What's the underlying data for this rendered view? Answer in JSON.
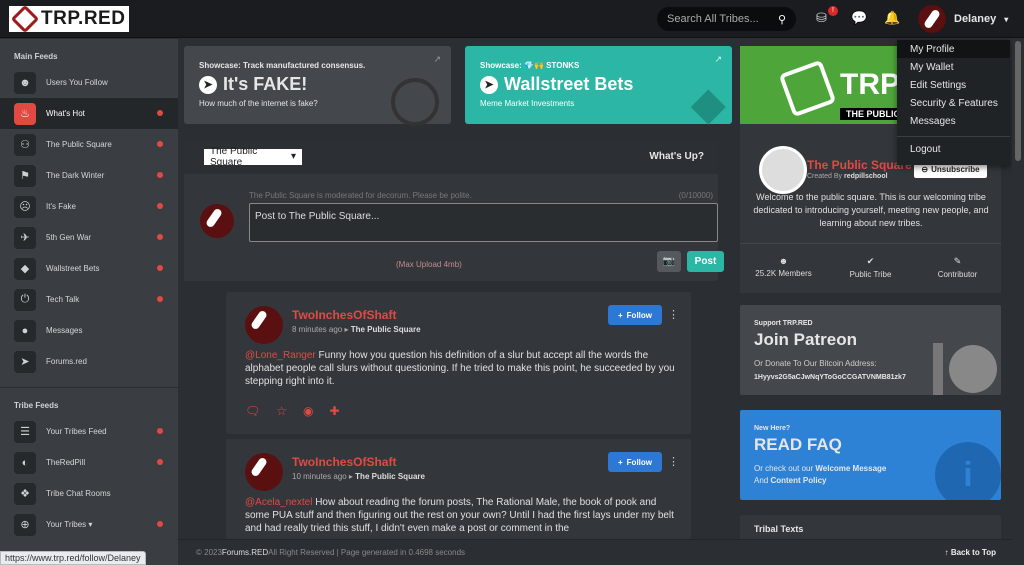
{
  "brand": {
    "logo": "TRP.RED"
  },
  "header": {
    "search_placeholder": "Search All Tribes...",
    "notification_count": "!",
    "username": "Delaney"
  },
  "user_menu": [
    "My Profile",
    "My Wallet",
    "Edit Settings",
    "Security & Features",
    "Messages",
    "Logout"
  ],
  "sidebar": {
    "main_title": "Main Feeds",
    "main": [
      {
        "label": "Users You Follow",
        "icon": "users-icon",
        "dot": false
      },
      {
        "label": "What's Hot",
        "icon": "fire-icon",
        "dot": true,
        "active": true
      },
      {
        "label": "The Public Square",
        "icon": "group-icon",
        "dot": true
      },
      {
        "label": "The Dark Winter",
        "icon": "flag-icon",
        "dot": true
      },
      {
        "label": "It's Fake",
        "icon": "dizzy-face-icon",
        "dot": true
      },
      {
        "label": "5th Gen War",
        "icon": "jet-icon",
        "dot": true
      },
      {
        "label": "Wallstreet Bets",
        "icon": "diamond-icon",
        "dot": true
      },
      {
        "label": "Tech Talk",
        "icon": "power-icon",
        "dot": true
      },
      {
        "label": "Messages",
        "icon": "chat-icon",
        "dot": false
      },
      {
        "label": "Forums.red",
        "icon": "arrow-circle-icon",
        "dot": false
      }
    ],
    "tribe_title": "Tribe Feeds",
    "tribe": [
      {
        "label": "Your Tribes Feed",
        "icon": "list-icon",
        "dot": true
      },
      {
        "label": "TheRedPill",
        "icon": "pills-icon",
        "dot": true
      },
      {
        "label": "Tribe Chat Rooms",
        "icon": "chat-bubbles-icon",
        "dot": false
      },
      {
        "label": "Your Tribes ▾",
        "icon": "globe-icon",
        "dot": true
      }
    ]
  },
  "showcase": [
    {
      "kicker": "Showcase: Track manufactured consensus.",
      "title": "It's FAKE!",
      "sub": "How much of the internet is fake?",
      "color": "#44484c"
    },
    {
      "kicker": "Showcase: 💎🙌 STONKS",
      "title": "Wallstreet Bets",
      "sub": "Meme Market Investments",
      "color": "#2bb6a5"
    }
  ],
  "composer": {
    "tribe_select": "The Public Square",
    "whats_up": "What's Up?",
    "note": "The Public Square is moderated for decorum. Please be polite.",
    "counter": "(0/10000)",
    "placeholder": "Post to The Public Square...",
    "max_upload": "(Max Upload 4mb)",
    "post": "Post"
  },
  "posts": [
    {
      "author": "TwoInchesOfShaft",
      "time": "8 minutes ago",
      "tribe": "The Public Square",
      "mention": "@Lone_Ranger",
      "text": " Funny how you question his definition of a slur but accept all the words the alphabet people call slurs without questioning. If he tried to make this point, he succeeded by you stepping right into it.",
      "follow": "Follow"
    },
    {
      "author": "TwoInchesOfShaft",
      "time": "10 minutes ago",
      "tribe": "The Public Square",
      "mention": "@Acela_nextel",
      "text": " How about reading the forum posts, The Rational Male, the book of pook and some PUA stuff and then figuring out the rest on your own? Until I had the first lays under my belt and had really tried this stuff, I didn't even make a post or comment in the",
      "follow": "Follow"
    }
  ],
  "tribe_card": {
    "banner": "TRP.RED",
    "banner_sub": "THE PUBLIC SQUARE",
    "name": "The Public Square",
    "created_by_label": "Created By",
    "created_by": "redpillschool",
    "unsubscribe": "Unsubscribe",
    "description": "Welcome to the public square. This is our welcoming tribe dedicated to introducing yourself, meeting new people, and learning about new tribes.",
    "stats": [
      {
        "label": "25.2K Members",
        "icon": "users-icon"
      },
      {
        "label": "Public Tribe",
        "icon": "check-icon"
      },
      {
        "label": "Contributor",
        "icon": "pen-icon"
      }
    ]
  },
  "support": {
    "kicker": "Support TRP.RED",
    "title": "Join Patreon",
    "line1": "Or Donate To Our Bitcoin Address:",
    "btc": "1Hyyvs2G5aCJwNqYToGoCCGATVNMB81zk7"
  },
  "faq": {
    "kicker": "New Here?",
    "title": "READ FAQ",
    "line1_a": "Or check out our ",
    "line1_b": "Welcome Message",
    "line2_a": "And ",
    "line2_b": "Content Policy"
  },
  "tribal_texts": "Tribal Texts",
  "footer": {
    "copy": "© 2023 ",
    "site": "Forums.RED",
    "rest": " All Right Reserved | Page generated in 0.4698 seconds",
    "back": "Back to Top"
  },
  "status_url": "https://www.trp.red/follow/Delaney"
}
